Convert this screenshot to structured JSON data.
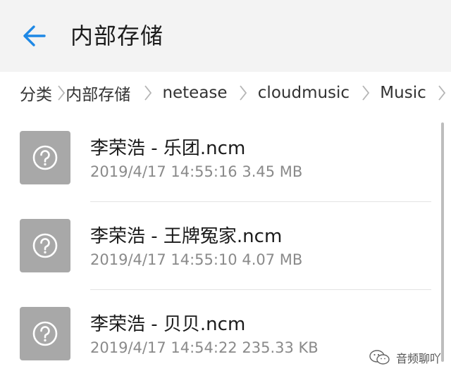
{
  "header": {
    "title": "内部存储"
  },
  "breadcrumb": {
    "items": [
      "分类",
      "内部存储",
      "netease",
      "cloudmusic",
      "Music"
    ]
  },
  "files": [
    {
      "name": "李荣浩 - 乐团.ncm",
      "date": "2019/4/17 14:55:16",
      "size": "3.45 MB"
    },
    {
      "name": "李荣浩 - 王牌冤家.ncm",
      "date": "2019/4/17 14:55:10",
      "size": "4.07 MB"
    },
    {
      "name": "李荣浩 - 贝贝.ncm",
      "date": "2019/4/17 14:54:22",
      "size": "235.33 KB"
    }
  ],
  "watermark": {
    "text": "音频聊吖"
  },
  "colors": {
    "accent": "#1e88e5",
    "titlebar_bg": "#f3f3f3",
    "icon_bg": "#a8a8a8",
    "meta_text": "#8a8a8a"
  },
  "icons": {
    "back": "arrow-left-icon",
    "separator": "chevron-right-icon",
    "file": "unknown-file-question-icon",
    "watermark": "wechat-icon"
  }
}
